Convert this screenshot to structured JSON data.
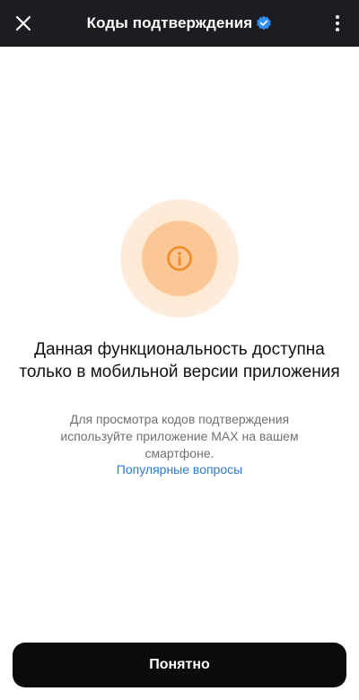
{
  "header": {
    "title": "Коды подтверждения",
    "close_icon": "close-icon",
    "verified_icon": "verified-badge-icon",
    "more_icon": "more-vertical-icon",
    "verified_color": "#2f8ff3"
  },
  "main": {
    "illustration_icon": "info-icon",
    "accent_color": "#f08a24",
    "heading": "Данная функциональность доступна только в мобильной версии приложения",
    "description": "Для просмотра кодов подтверждения используйте приложение MAX на вашем смартфоне.",
    "faq_link": "Популярные вопросы"
  },
  "footer": {
    "button_label": "Понятно"
  }
}
